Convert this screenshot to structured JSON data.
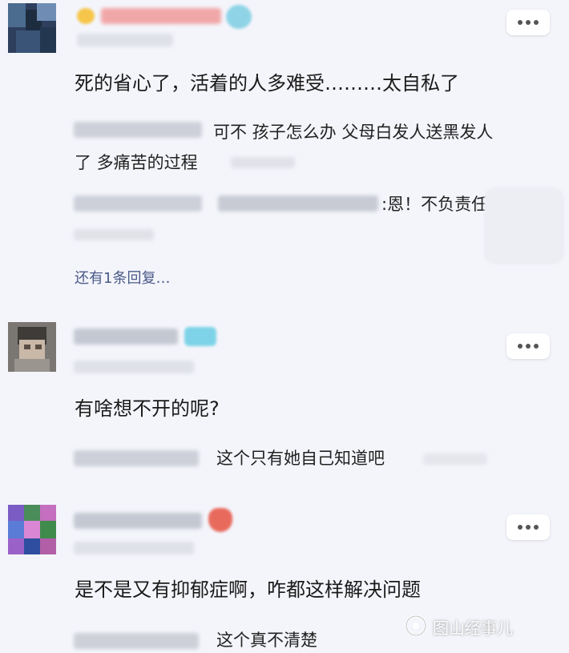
{
  "comments": [
    {
      "text": "死的省心了，活着的人多难受………太自私了",
      "replies": [
        {
          "text": "可不 孩子怎么办 父母白发人送黑发人",
          "text2": "了 多痛苦的过程"
        },
        {
          "text": ":恩！不负责任"
        }
      ],
      "more_replies": "还有1条回复…"
    },
    {
      "text": "有啥想不开的呢?",
      "replies": [
        {
          "text": "这个只有她自己知道吧"
        }
      ]
    },
    {
      "text": "是不是又有抑郁症啊，咋都这样解决问题",
      "replies": [
        {
          "text": "这个真不清楚"
        }
      ]
    }
  ],
  "watermark": {
    "text": "图山经事儿"
  },
  "colors": {
    "background": "#f4f5fb",
    "link": "#4a5a88",
    "card": "#ffffff"
  },
  "icons": [
    "more-options-icon",
    "vip-badge-icon",
    "heart-badge-icon",
    "watermark-logo-icon"
  ]
}
